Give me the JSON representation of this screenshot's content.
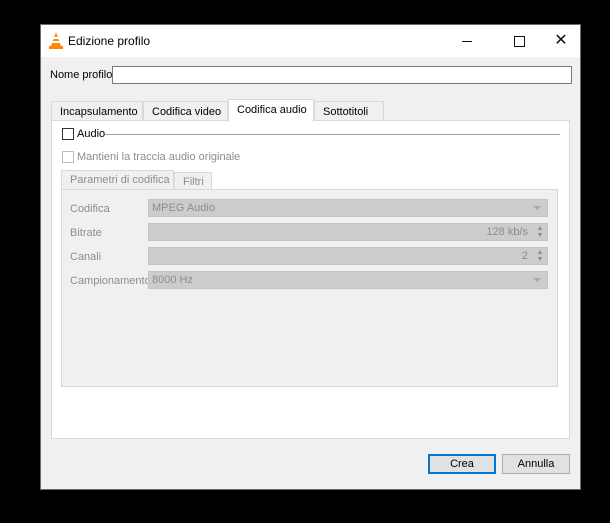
{
  "window": {
    "title": "Edizione profilo"
  },
  "profile": {
    "name_label": "Nome profilo",
    "name_value": ""
  },
  "tabs": [
    {
      "label": "Incapsulamento"
    },
    {
      "label": "Codifica video"
    },
    {
      "label": "Codifica audio"
    },
    {
      "label": "Sottotitoli"
    }
  ],
  "active_tab": "Codifica audio",
  "audio": {
    "checkbox_label": "Audio",
    "keep_original_label": "Mantieni la traccia audio originale",
    "subtabs": [
      {
        "label": "Parametri di codifica"
      },
      {
        "label": "Filtri"
      }
    ],
    "fields": {
      "codec_label": "Codifica",
      "codec_value": "MPEG Audio",
      "bitrate_label": "Bitrate",
      "bitrate_value": "128 kb/s",
      "channels_label": "Canali",
      "channels_value": "2",
      "samplerate_label": "Campionamento",
      "samplerate_value": "8000 Hz"
    }
  },
  "buttons": {
    "create": "Crea",
    "cancel": "Annulla"
  },
  "icons": {
    "app": "vlc-cone-icon",
    "minimize": "minimize-icon",
    "maximize": "maximize-icon",
    "close": "close-icon"
  },
  "colors": {
    "accent": "#0078d7",
    "disabled_field": "#cccccc",
    "window_bg": "#f0f0f0"
  }
}
